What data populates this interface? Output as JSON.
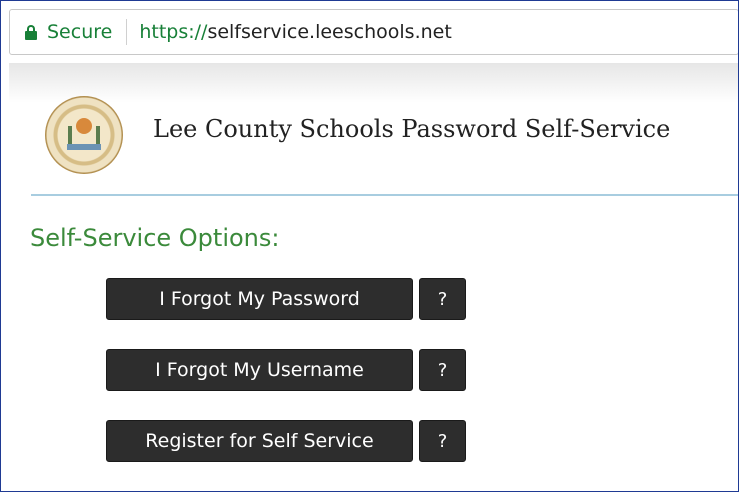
{
  "browser": {
    "security_label": "Secure",
    "url_scheme": "https://",
    "url_host": "selfservice.leeschools.net",
    "lock_icon": "lock-icon"
  },
  "header": {
    "logo": "school-district-seal",
    "title": "Lee County Schools Password Self-Service"
  },
  "options": {
    "heading": "Self-Service Options:",
    "buttons": [
      {
        "label": "I Forgot My Password",
        "help": "?"
      },
      {
        "label": "I Forgot My Username",
        "help": "?"
      },
      {
        "label": "Register for Self Service",
        "help": "?"
      }
    ]
  },
  "colors": {
    "secure_green": "#188038",
    "heading_green": "#3b8a3b",
    "button_bg": "#2d2d2d",
    "rule_blue": "#a8cde0"
  }
}
